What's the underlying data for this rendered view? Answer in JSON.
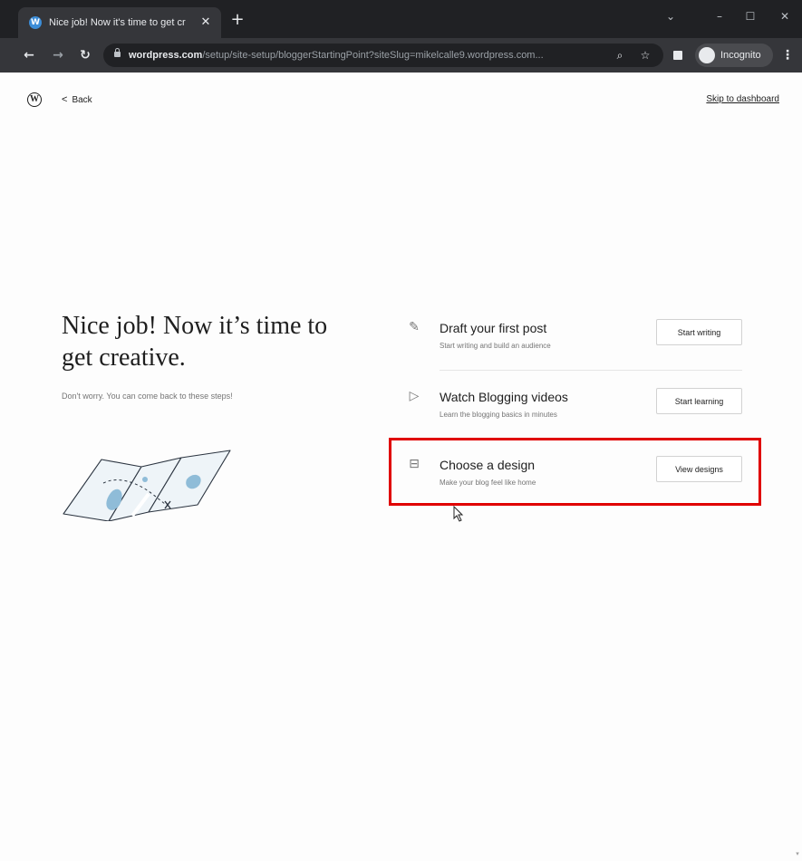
{
  "browser": {
    "tab_title": "Nice job! Now it's time to get cr",
    "tab_close": "✕",
    "new_tab": "+",
    "url_host": "wordpress.com",
    "url_path": "/setup/site-setup/bloggerStartingPoint?siteSlug=mikelcalle9.wordpress.com...",
    "incognito_label": "Incognito",
    "window_controls": [
      "⌄",
      "–",
      "☐",
      "✕"
    ],
    "nav": {
      "back": "←",
      "forward": "→",
      "reload": "↻"
    },
    "omnibox_icons": [
      "zoom-icon",
      "star-icon"
    ],
    "menu": "⋮"
  },
  "header": {
    "logo": "W",
    "back_chevron": "<",
    "back_label": "Back",
    "skip_label": "Skip to dashboard"
  },
  "intro": {
    "title": "Nice job! Now it’s time to get creative.",
    "subtitle": "Don't worry. You can come back to these steps!"
  },
  "tasks": [
    {
      "icon": "feather-icon",
      "glyph": "✎",
      "title": "Draft your first post",
      "description": "Start writing and build an audience",
      "button": "Start writing"
    },
    {
      "icon": "play-icon",
      "glyph": "▷",
      "title": "Watch Blogging videos",
      "description": "Learn the blogging basics in minutes",
      "button": "Start learning"
    },
    {
      "icon": "layout-icon",
      "glyph": "⊟",
      "title": "Choose a design",
      "description": "Make your blog feel like home",
      "button": "View designs"
    }
  ],
  "colors": {
    "highlight": "#e00000",
    "map_accent": "#8fbcd8",
    "chrome_dark": "#202124"
  },
  "scroll_arrow": "▾"
}
